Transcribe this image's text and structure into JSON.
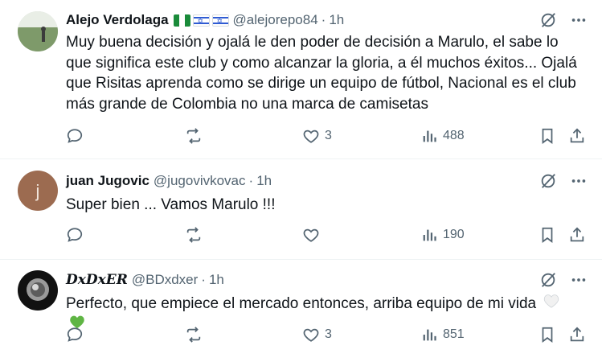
{
  "replies": [
    {
      "display_name": "Alejo Verdolaga",
      "handle": "@alejorepo84",
      "time": "1h",
      "text": "Muy buena decisión y ojalá le den poder de decisión a Marulo, el sabe lo que significa este club y como alcanzar la gloria, a él muchos éxitos... Ojalá que Risitas aprenda como se dirige un equipo de fútbol, Nacional es el club más grande de Colombia no una marca de camisetas",
      "likes": "3",
      "views": "488",
      "flags": [
        "nigeria-flag",
        "israel-flag",
        "israel-flag"
      ]
    },
    {
      "display_name": "juan Jugovic",
      "handle": "@jugovivkovac",
      "time": "1h",
      "text": "Super bien ... Vamos Marulo !!!",
      "likes": "",
      "views": "190",
      "avatar_letter": "j",
      "avatar_color": "#9c6b50"
    },
    {
      "display_name": "𝑫𝒙𝑫𝒙𝑬𝑹",
      "handle": "@BDxdxer",
      "time": "1h",
      "text": "Perfecto, que empiece el mercado entonces, arriba equipo de mi vida",
      "likes": "3",
      "views": "851",
      "emojis": [
        "white-heart",
        "green-heart"
      ]
    }
  ],
  "ui": {
    "separator": "·"
  },
  "colors": {
    "muted": "#536471",
    "text": "#0f1419",
    "divider": "#eff3f4"
  }
}
